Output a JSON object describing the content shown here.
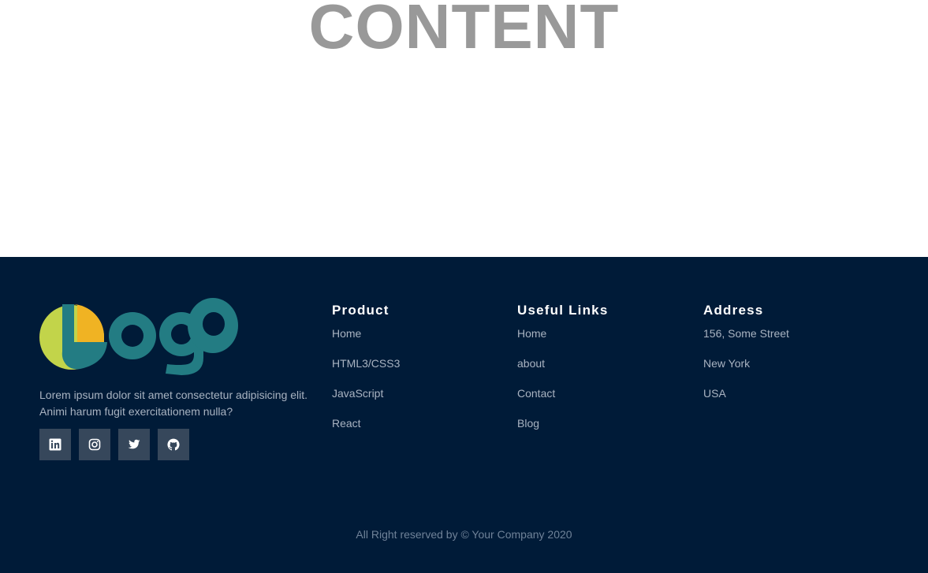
{
  "content": {
    "heading": "CONTENT"
  },
  "footer": {
    "logo_alt": "Logo",
    "about": {
      "line1": "Lorem ipsum dolor sit amet consectetur adipisicing elit.",
      "line2": "Animi harum fugit exercitationem nulla?"
    },
    "socials": [
      {
        "icon": "linkedin-icon"
      },
      {
        "icon": "instagram-icon"
      },
      {
        "icon": "twitter-icon"
      },
      {
        "icon": "github-icon"
      }
    ],
    "product": {
      "title": "Product",
      "items": [
        "Home",
        "HTML3/CSS3",
        "JavaScript",
        "React"
      ]
    },
    "useful_links": {
      "title": "Useful Links",
      "items": [
        "Home",
        "about",
        "Contact",
        "Blog"
      ]
    },
    "address": {
      "title": "Address",
      "items": [
        "156, Some Street",
        "New York",
        "USA"
      ]
    },
    "copyright": "All Right reserved by © Your Company 2020"
  },
  "colors": {
    "footer_bg": "#001b38",
    "social_bg": "#36475b",
    "heading_gray": "#999999",
    "logo_lime": "#c2d44a",
    "logo_yellow": "#f0b323",
    "logo_teal": "#237c83"
  }
}
